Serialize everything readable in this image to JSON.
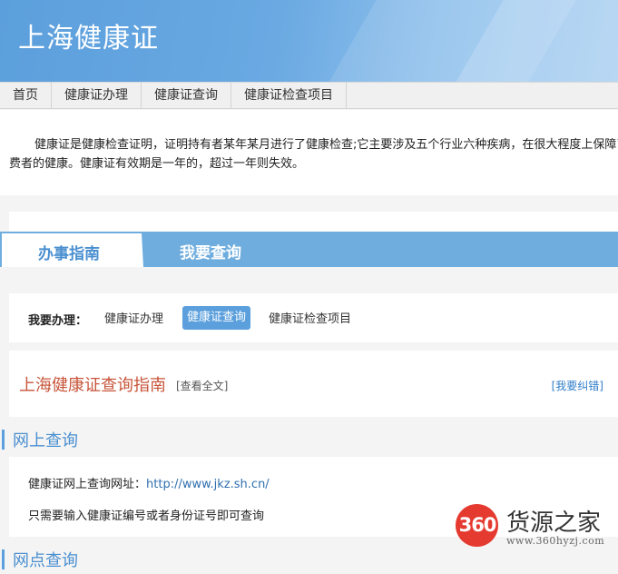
{
  "banner": {
    "title": "上海健康证"
  },
  "nav": {
    "items": [
      {
        "label": "首页"
      },
      {
        "label": "健康证办理"
      },
      {
        "label": "健康证查询"
      },
      {
        "label": "健康证检查项目"
      }
    ]
  },
  "intro": {
    "text": "健康证是健康检查证明，证明持有者某年某月进行了健康检查;它主要涉及五个行业六种疾病，在很大程度上保障了消费者的健康。健康证有效期是一年的，超过一年则失效。"
  },
  "tabs": {
    "active": "办事指南",
    "second": "我要查询"
  },
  "action_bar": {
    "label": "我要办理：",
    "links": [
      {
        "label": "健康证办理"
      },
      {
        "label": "健康证查询"
      },
      {
        "label": "健康证检查项目"
      }
    ]
  },
  "guide": {
    "title": "上海健康证查询指南",
    "full_text_link": "[查看全文]",
    "report_link": "[我要纠错]"
  },
  "sections": {
    "online_title": "网上查询",
    "online_row1_label": "健康证网上查询网址：",
    "online_row1_url": "http://www.jkz.sh.cn/",
    "online_row2": "只需要输入健康证编号或者身份证号即可查询",
    "outlet_title": "网点查询"
  },
  "watermark": {
    "number": "360",
    "name": "货源之家",
    "url": "www.360hyzj.com"
  },
  "colors": {
    "accent": "#5b9fdc",
    "tab_bar": "#6fadde",
    "guide_title": "#c8553a",
    "link": "#2f6fb0",
    "watermark_red": "#e53a2f"
  }
}
